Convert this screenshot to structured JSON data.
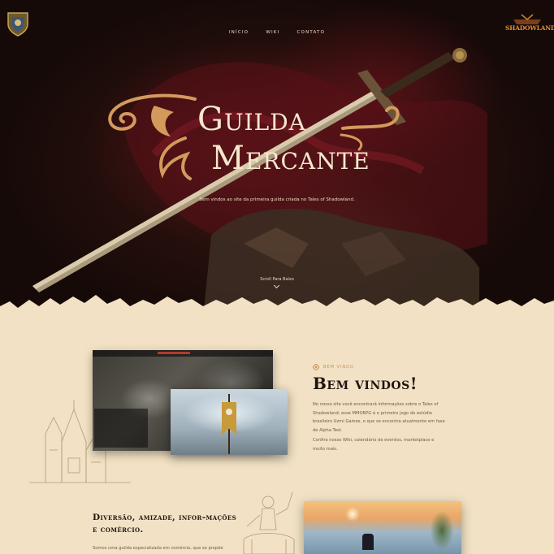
{
  "nav": {
    "items": [
      {
        "label": "INÍCIO"
      },
      {
        "label": "WIKI"
      },
      {
        "label": "CONTATO"
      }
    ]
  },
  "logos": {
    "guild_crest_icon": "guild-crest-icon",
    "game_logo_text": "SHADOWLAND"
  },
  "hero": {
    "title_line1": "Guilda",
    "title_line2": "Mercante",
    "subtitle": "Bem vindos ao site da primeira guilda criada no Tales of Shadowland.",
    "scroll_label": "Scroll Para Baixo"
  },
  "welcome": {
    "kicker": "BEM VINDO",
    "title": "Bem vindos!",
    "paragraph1": "No nosso site você encontrará informações sobre o Tales of Shadowland; esse MMORPG é o primeiro jogo do estúdio brasileiro Uzmi Games, o que se encontra atualmente em fase de Alpha Test.",
    "paragraph2": "Confira nosso Wiki, calendário de eventos, marketplace e muito mais."
  },
  "fun": {
    "title": "Diversão, amizade, infor-mações e comércio.",
    "paragraph": "Somos uma guilda especializada em comércio, que se propõe"
  },
  "colors": {
    "hero_dark": "#160a08",
    "cream": "#f2e1c4",
    "ornament_gold": "#d39a5c",
    "title_text": "#f6e7cf",
    "kicker": "#c39055",
    "heading": "#1e1510",
    "body": "#6e5a45"
  }
}
